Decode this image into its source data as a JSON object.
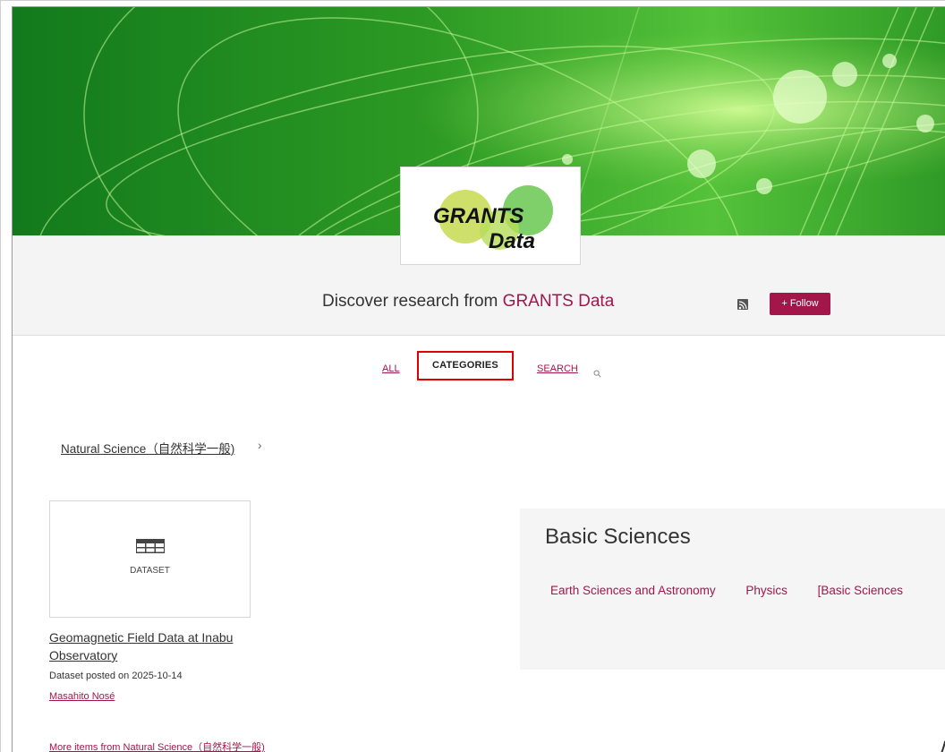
{
  "logo": {
    "line1": "GRANTS",
    "line2": "Data"
  },
  "header": {
    "headline_prefix": "Discover research from ",
    "headline_brand": "GRANTS Data",
    "rss_icon": "rss-icon",
    "follow_label": "+ Follow"
  },
  "tabs": {
    "all": "ALL",
    "categories": "CATEGORIES",
    "search": "SEARCH",
    "search_icon": "search-icon"
  },
  "breadcrumb": {
    "label": "Natural Science（自然科学一般)",
    "chevron": "›"
  },
  "item": {
    "type_icon": "table-icon",
    "type": "DATASET",
    "title": "Geomagnetic Field Data at Inabu Observatory",
    "meta": "Dataset posted on 2025-10-14",
    "author": "Masahito Nosé"
  },
  "more_link": "More items from Natural Science（自然科学一般)",
  "panel": {
    "title": "Basic Sciences",
    "links": [
      "Earth Sciences and Astronomy",
      "Physics",
      "[Basic Sciences"
    ]
  },
  "corner_text": "ム",
  "colors": {
    "accent": "#a3164a",
    "banner_green": "#2e9a2e",
    "highlight_box": "#e00000"
  }
}
